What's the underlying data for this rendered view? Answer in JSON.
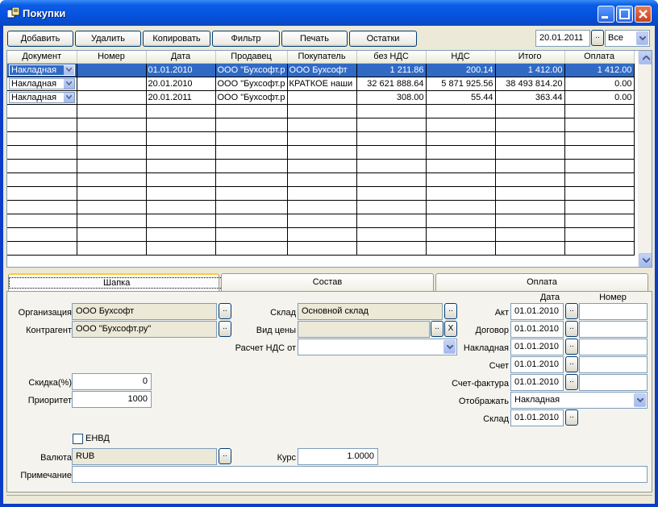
{
  "window": {
    "title": "Покупки"
  },
  "toolbar": {
    "add": "Добавить",
    "delete": "Удалить",
    "copy": "Копировать",
    "filter": "Фильтр",
    "print": "Печать",
    "remains": "Остатки",
    "date": "20.01.2011",
    "dots": "..",
    "period": "Все"
  },
  "grid": {
    "columns": [
      "Документ",
      "Номер",
      "Дата",
      "Продавец",
      "Покупатель",
      "без НДС",
      "НДС",
      "Итого",
      "Оплата"
    ],
    "rows": [
      {
        "doc": "Накладная",
        "num": "",
        "date": "01.01.2010",
        "seller": "ООО \"Бухсофт.р",
        "buyer": "ООО Бухсофт",
        "net": "1 211.86",
        "vat": "200.14",
        "total": "1 412.00",
        "paid": "1 412.00"
      },
      {
        "doc": "Накладная",
        "num": "",
        "date": "20.01.2010",
        "seller": "ООО \"Бухсофт.р",
        "buyer": "КРАТКОЕ наши",
        "net": "32 621 888.64",
        "vat": "5 871 925.56",
        "total": "38 493 814.20",
        "paid": "0.00"
      },
      {
        "doc": "Накладная",
        "num": "",
        "date": "20.01.2011",
        "seller": "ООО \"Бухсофт.р",
        "buyer": "",
        "net": "308.00",
        "vat": "55.44",
        "total": "363.44",
        "paid": "0.00"
      }
    ]
  },
  "tabs": {
    "header": "Шапка",
    "content": "Состав",
    "payment": "Оплата"
  },
  "form": {
    "org_label": "Организация",
    "org": "ООО Бухсофт",
    "contr_label": "Контрагент",
    "contr": "ООО \"Бухсофт.ру\"",
    "store_label": "Склад",
    "store": "Основной склад",
    "price_label": "Вид цены",
    "price": "",
    "vat_label": "Расчет НДС от",
    "vat": "",
    "discount_label": "Скидка(%)",
    "discount": "0",
    "priority_label": "Приоритет",
    "priority": "1000",
    "envd_label": "ЕНВД",
    "currency_label": "Валюта",
    "currency": "RUB",
    "rate_label": "Курс",
    "rate": "1.0000",
    "note_label": "Примечание",
    "note": "",
    "dots": "..",
    "clear": "X"
  },
  "docs": {
    "date_header": "Дата",
    "number_header": "Номер",
    "act_label": "Акт",
    "act_date": "01.01.2010",
    "contract_label": "Договор",
    "contract_date": "01.01.2010",
    "waybill_label": "Накладная",
    "waybill_date": "01.01.2010",
    "invoice_label": "Счет",
    "invoice_date": "01.01.2010",
    "taxinv_label": "Счет-фактура",
    "taxinv_date": "01.01.2010",
    "display_label": "Отображать",
    "display": "Накладная",
    "store_label": "Склад",
    "store_date": "01.01.2010"
  }
}
